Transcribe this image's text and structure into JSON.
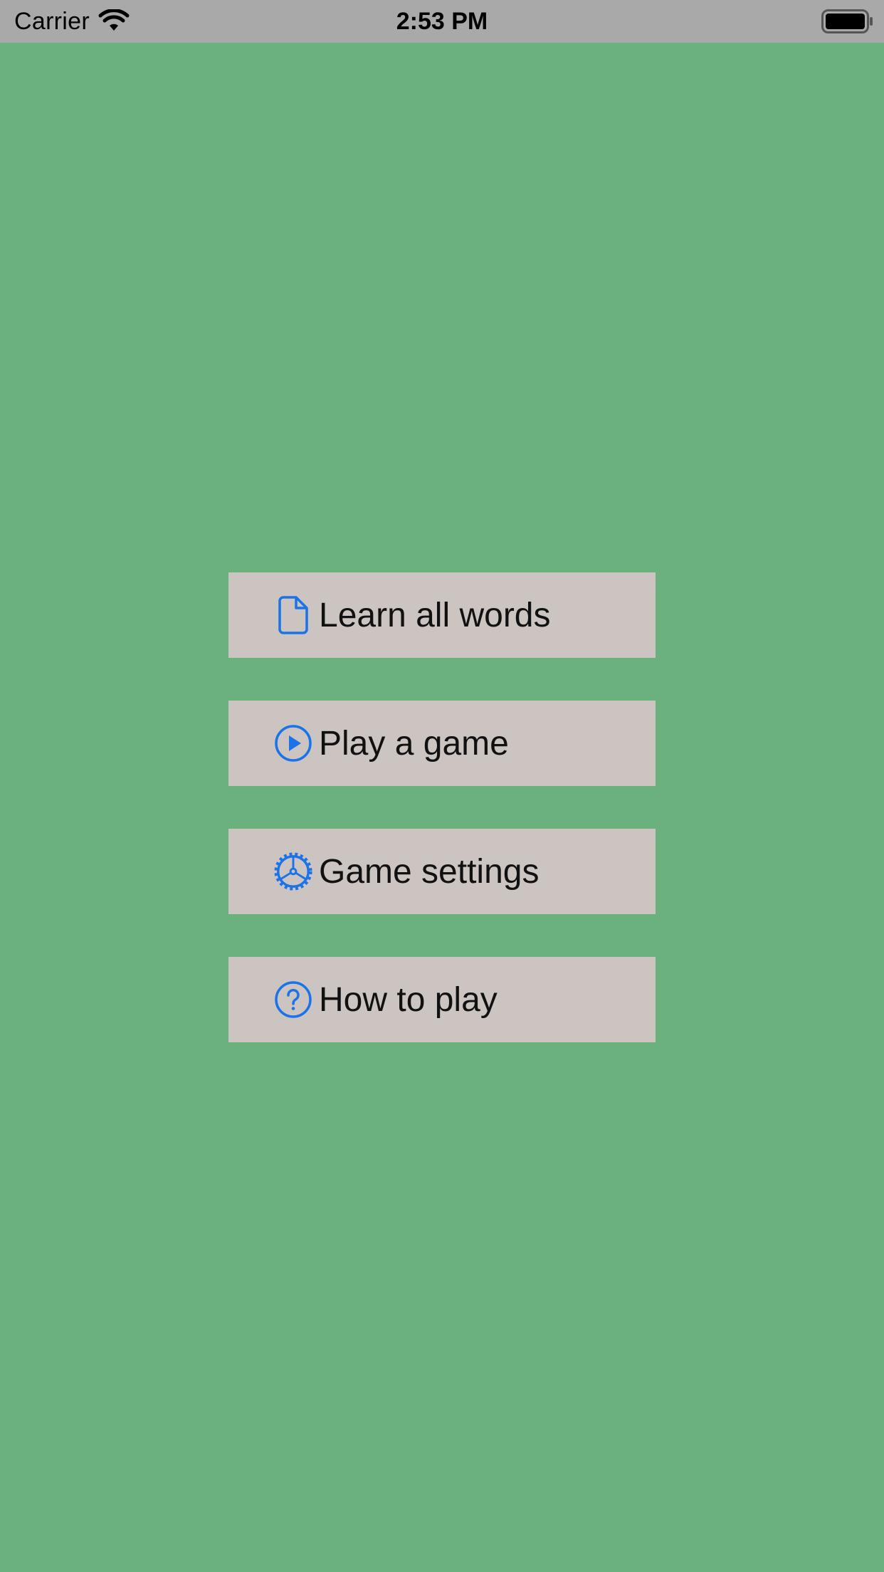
{
  "status_bar": {
    "carrier": "Carrier",
    "time": "2:53 PM",
    "wifi_icon": "wifi-icon",
    "battery_icon": "battery-icon"
  },
  "colors": {
    "background": "#6ab17e",
    "status_bar": "#a9a9a9",
    "button_background": "#ccc4c1",
    "icon_accent": "#1a73e8"
  },
  "menu": {
    "items": [
      {
        "label": "Learn all words",
        "icon": "document-icon"
      },
      {
        "label": "Play a game",
        "icon": "play-circle-icon"
      },
      {
        "label": "Game settings",
        "icon": "gear-icon"
      },
      {
        "label": "How to play",
        "icon": "question-circle-icon"
      }
    ]
  }
}
